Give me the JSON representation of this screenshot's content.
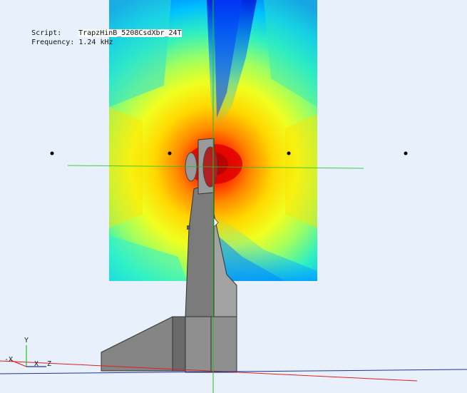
{
  "overlay": {
    "script_label": "Script:",
    "script_value": "TrapzHinB_5208CsdXbr_24T",
    "frequency_label": "Frequency:",
    "frequency_value": "1.24 kHz"
  },
  "axes": {
    "neg_x": "-X",
    "y": "Y",
    "x": "X",
    "z": "Z"
  },
  "colors": {
    "background": "#e8f1fb",
    "x_axis_line": "#e02020",
    "y_axis_line": "#20c020",
    "z_axis_line": "#2030a0",
    "speaker_body": "#8a8a8a"
  },
  "color_scale": [
    "#0020ff",
    "#0090ff",
    "#00e0ff",
    "#60ff90",
    "#e0ff30",
    "#ffe000",
    "#ff9000",
    "#ff3000",
    "#d00000"
  ],
  "markers": {
    "count": 4
  }
}
